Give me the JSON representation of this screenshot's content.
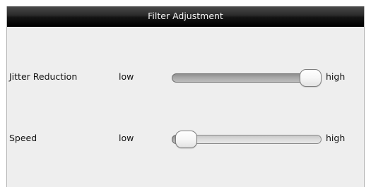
{
  "window": {
    "title": "Filter Adjustment"
  },
  "sliders": [
    {
      "label": "Jitter Reduction",
      "min_label": "low",
      "max_label": "high",
      "value": 1.0
    },
    {
      "label": "Speed",
      "min_label": "low",
      "max_label": "high",
      "value": 0.0
    }
  ],
  "colors": {
    "titlebar": "#1a1a1a",
    "panel": "#eeeeee"
  }
}
